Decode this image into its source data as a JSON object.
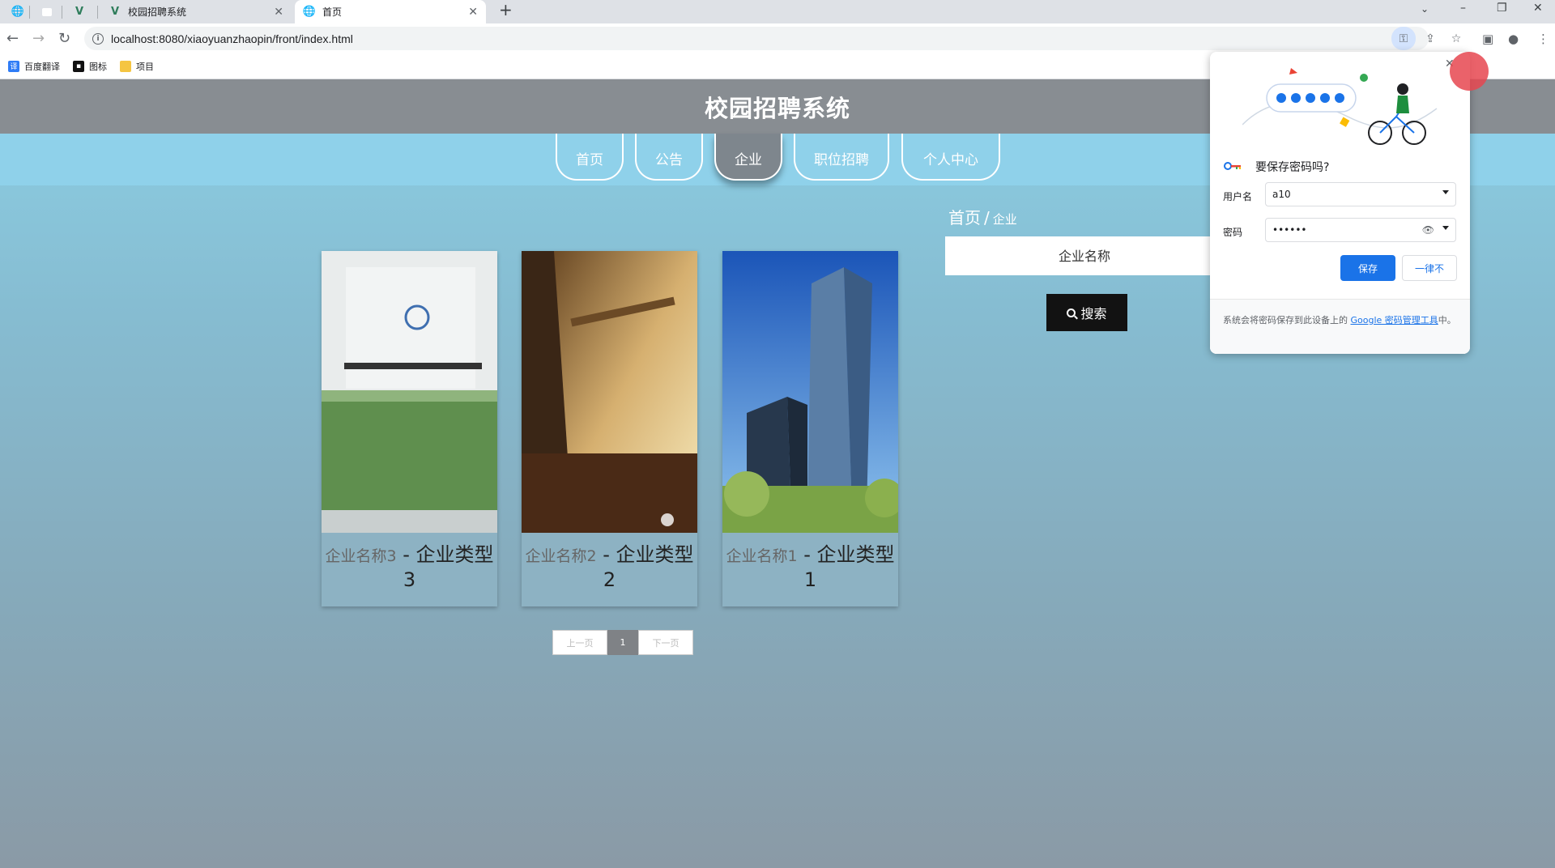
{
  "browser": {
    "tabs": [
      {
        "label": ""
      },
      {
        "label": ""
      },
      {
        "label": "校园招聘系统"
      },
      {
        "label": "首页"
      }
    ],
    "url": "localhost:8080/xiaoyuanzhaopin/front/index.html",
    "bookmarks": [
      {
        "label": "百度翻译",
        "icon": "translate-icon"
      },
      {
        "label": "图标",
        "icon": "image-icon"
      },
      {
        "label": "项目",
        "icon": "folder-icon"
      }
    ]
  },
  "site": {
    "title": "校园招聘系统",
    "nav": [
      {
        "label": "首页"
      },
      {
        "label": "公告"
      },
      {
        "label": "企业",
        "active": true
      },
      {
        "label": "职位招聘"
      },
      {
        "label": "个人中心"
      }
    ],
    "breadcrumb": {
      "root": "首页",
      "separator": "/",
      "current": "企业"
    },
    "search": {
      "placeholder": "企业名称",
      "button": "搜索"
    },
    "cards": [
      {
        "name": "企业名称3",
        "dash": " - ",
        "type": "企业类型3"
      },
      {
        "name": "企业名称2",
        "dash": " - ",
        "type": "企业类型2"
      },
      {
        "name": "企业名称1",
        "dash": " - ",
        "type": "企业类型1"
      }
    ],
    "pager": {
      "prev": "上一页",
      "current": "1",
      "next": "下一页"
    }
  },
  "password_popup": {
    "title": "要保存密码吗?",
    "username_label": "用户名",
    "username_value": "a10",
    "password_label": "密码",
    "password_value": "••••••",
    "save_label": "保存",
    "never_label": "一律不",
    "footer_text": "系统会将密码保存到此设备上的 ",
    "footer_link": "Google 密码管理工具",
    "footer_tail": "中。"
  },
  "colors": {
    "header_bg": "#888d92",
    "nav_band": "#8fd1ea",
    "accent_blue": "#1a73e8",
    "search_button": "#121212"
  }
}
